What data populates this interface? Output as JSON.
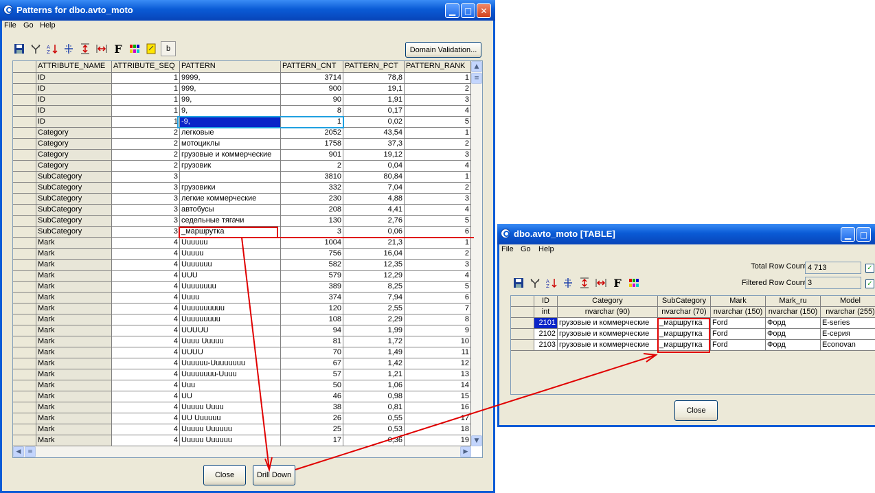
{
  "colors": {
    "titlebar": "#0a5bd6",
    "selection": "#0a24c8",
    "annotation_red": "#e00000",
    "cursor_blue": "#1fa0e0"
  },
  "window1": {
    "title": "Patterns for dbo.avto_moto",
    "menu": [
      "File",
      "Go",
      "Help"
    ],
    "toolbar_icons": [
      "save-icon",
      "filter-icon",
      "sort-icon",
      "columns-icon",
      "row-height-icon",
      "col-width-icon",
      "font-icon",
      "colors-icon",
      "note-icon",
      "b-icon"
    ],
    "toolbar_b_label": "b",
    "domain_validation_label": "Domain Validation...",
    "columns": [
      "ATTRIBUTE_NAME",
      "ATTRIBUTE_SEQ",
      "PATTERN",
      "PATTERN_CNT",
      "PATTERN_PCT",
      "PATTERN_RANK"
    ],
    "rows": [
      [
        "ID",
        "1",
        "9999,",
        "3714",
        "78,8",
        "1"
      ],
      [
        "ID",
        "1",
        "999,",
        "900",
        "19,1",
        "2"
      ],
      [
        "ID",
        "1",
        "99,",
        "90",
        "1,91",
        "3"
      ],
      [
        "ID",
        "1",
        "9,",
        "8",
        "0,17",
        "4"
      ],
      [
        "ID",
        "1",
        "-9,",
        "1",
        "0,02",
        "5"
      ],
      [
        "Category",
        "2",
        "легковые",
        "2052",
        "43,54",
        "1"
      ],
      [
        "Category",
        "2",
        "мотоциклы",
        "1758",
        "37,3",
        "2"
      ],
      [
        "Category",
        "2",
        "грузовые и коммерческие",
        "901",
        "19,12",
        "3"
      ],
      [
        "Category",
        "2",
        "грузовик",
        "2",
        "0,04",
        "4"
      ],
      [
        "SubCategory",
        "3",
        "",
        "3810",
        "80,84",
        "1"
      ],
      [
        "SubCategory",
        "3",
        "грузовики",
        "332",
        "7,04",
        "2"
      ],
      [
        "SubCategory",
        "3",
        "легкие коммерческие",
        "230",
        "4,88",
        "3"
      ],
      [
        "SubCategory",
        "3",
        "автобусы",
        "208",
        "4,41",
        "4"
      ],
      [
        "SubCategory",
        "3",
        "седельные тягачи",
        "130",
        "2,76",
        "5"
      ],
      [
        "SubCategory",
        "3",
        "_маршрутка",
        "3",
        "0,06",
        "6"
      ],
      [
        "Mark",
        "4",
        "Uuuuuu",
        "1004",
        "21,3",
        "1"
      ],
      [
        "Mark",
        "4",
        "Uuuuu",
        "756",
        "16,04",
        "2"
      ],
      [
        "Mark",
        "4",
        "Uuuuuuu",
        "582",
        "12,35",
        "3"
      ],
      [
        "Mark",
        "4",
        "UUU",
        "579",
        "12,29",
        "4"
      ],
      [
        "Mark",
        "4",
        "Uuuuuuuu",
        "389",
        "8,25",
        "5"
      ],
      [
        "Mark",
        "4",
        "Uuuu",
        "374",
        "7,94",
        "6"
      ],
      [
        "Mark",
        "4",
        "Uuuuuuuuuu",
        "120",
        "2,55",
        "7"
      ],
      [
        "Mark",
        "4",
        "Uuuuuuuuu",
        "108",
        "2,29",
        "8"
      ],
      [
        "Mark",
        "4",
        "UUUUU",
        "94",
        "1,99",
        "9"
      ],
      [
        "Mark",
        "4",
        "Uuuu Uuuuu",
        "81",
        "1,72",
        "10"
      ],
      [
        "Mark",
        "4",
        "UUUU",
        "70",
        "1,49",
        "11"
      ],
      [
        "Mark",
        "4",
        "Uuuuuu-Uuuuuuuu",
        "67",
        "1,42",
        "12"
      ],
      [
        "Mark",
        "4",
        "Uuuuuuuu-Uuuu",
        "57",
        "1,21",
        "13"
      ],
      [
        "Mark",
        "4",
        "Uuu",
        "50",
        "1,06",
        "14"
      ],
      [
        "Mark",
        "4",
        "UU",
        "46",
        "0,98",
        "15"
      ],
      [
        "Mark",
        "4",
        "Uuuuu Uuuu",
        "38",
        "0,81",
        "16"
      ],
      [
        "Mark",
        "4",
        "UU Uuuuuu",
        "26",
        "0,55",
        "17"
      ],
      [
        "Mark",
        "4",
        "Uuuuu Uuuuuu",
        "25",
        "0,53",
        "18"
      ],
      [
        "Mark",
        "4",
        "Uuuuu Uuuuuu",
        "17",
        "0,36",
        "19"
      ]
    ],
    "close_label": "Close",
    "drilldown_label": "Drill Down"
  },
  "window2": {
    "title": "dbo.avto_moto [TABLE]",
    "menu": [
      "File",
      "Go",
      "Help"
    ],
    "toolbar_icons": [
      "save-icon",
      "filter-icon",
      "sort-icon",
      "columns-icon",
      "row-height-icon",
      "col-width-icon",
      "font-icon",
      "colors-icon"
    ],
    "total_label": "Total Row Count:",
    "total_value": "4 713",
    "filtered_label": "Filtered Row Count:",
    "filtered_value": "3",
    "columns": [
      "ID",
      "Category",
      "SubCategory",
      "Mark",
      "Mark_ru",
      "Model"
    ],
    "types": [
      "int",
      "nvarchar (90)",
      "nvarchar (70)",
      "nvarchar (150)",
      "nvarchar (150)",
      "nvarchar (255)"
    ],
    "rows": [
      [
        "2101",
        "грузовые и коммерческие",
        "_маршрутка",
        "Ford",
        "Форд",
        "E-series"
      ],
      [
        "2102",
        "грузовые и коммерческие",
        "_маршрутка",
        "Ford",
        "Форд",
        "E-серия"
      ],
      [
        "2103",
        "грузовые и коммерческие",
        "_маршрутка",
        "Ford",
        "Форд",
        "Econovan"
      ]
    ],
    "close_label": "Close"
  }
}
